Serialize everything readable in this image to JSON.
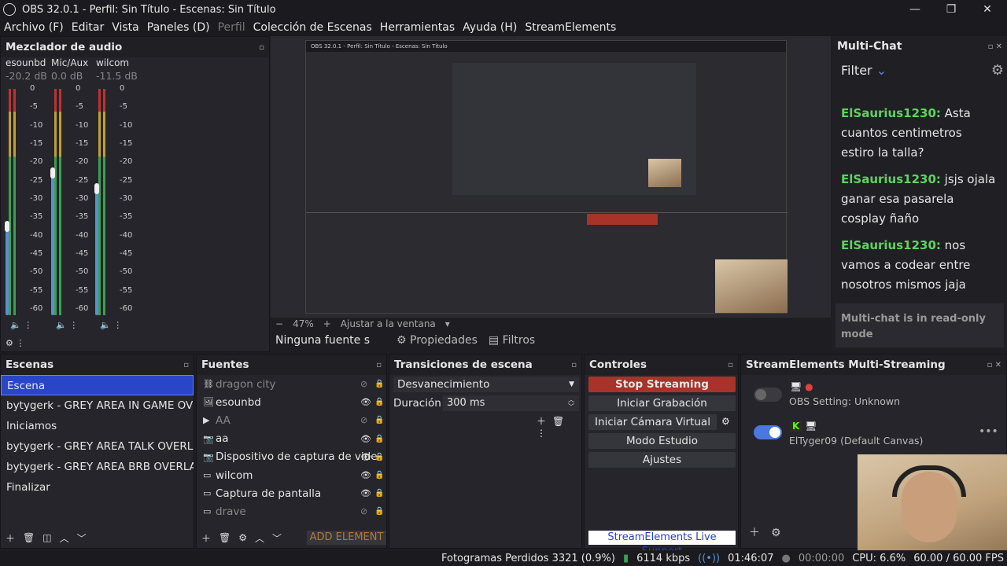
{
  "titlebar": {
    "title": "OBS 32.0.1 - Perfil: Sin Título - Escenas: Sin Título",
    "min": "—",
    "max": "❐",
    "close": "✕"
  },
  "menu": [
    "Archivo (F)",
    "Editar",
    "Vista",
    "Paneles (D)",
    "Perfil",
    "Colección de Escenas",
    "Herramientas",
    "Ayuda (H)",
    "StreamElements"
  ],
  "mixer": {
    "title": "Mezclador de audio",
    "channels": [
      {
        "name": "esounbd",
        "db": "-20.2 dB"
      },
      {
        "name": "Mic/Aux",
        "db": "0.0 dB"
      },
      {
        "name": "wilcom",
        "db": "-11.5 dB"
      }
    ],
    "ticks": [
      "0",
      "-5",
      "-10",
      "-15",
      "-20",
      "-25",
      "-30",
      "-35",
      "-40",
      "-45",
      "-50",
      "-55",
      "-60"
    ]
  },
  "preview": {
    "zoom": "47%",
    "fit": "Ajustar a la ventana",
    "minus": "−",
    "plus": "+"
  },
  "sourcebar": {
    "no_source": "Ninguna fuente s",
    "properties": "Propiedades",
    "filters": "Filtros"
  },
  "multichat": {
    "title": "Multi-Chat",
    "filter": "Filter",
    "messages": [
      {
        "user": "ElSaurius1230:",
        "text": "Asta cuantos centimetros estiro la talla?"
      },
      {
        "user": "ElSaurius1230:",
        "text": "jsjs ojala ganar esa pasarela cosplay ñaño"
      },
      {
        "user": "ElSaurius1230:",
        "text": "nos vamos a codear entre nosotros mismos jaja"
      }
    ],
    "readonly": "Multi-chat is in read-only mode"
  },
  "scenes": {
    "title": "Escenas",
    "items": [
      "Escena",
      "bytygerk - GREY AREA IN GAME OVERLAY",
      "Iniciamos",
      "bytygerk - GREY AREA TALK OVERLAY",
      "bytygerk - GREY AREA BRB OVERLAY",
      "Finalizar"
    ]
  },
  "sources": {
    "title": "Fuentes",
    "items": [
      {
        "name": "dragon city",
        "dim": true
      },
      {
        "name": "esounbd"
      },
      {
        "name": "AA",
        "dim": true
      },
      {
        "name": "aa"
      },
      {
        "name": "Dispositivo de captura de vide"
      },
      {
        "name": "wilcom"
      },
      {
        "name": "Captura de pantalla"
      },
      {
        "name": "drave",
        "dim": true
      }
    ],
    "add": "ADD ELEMENT"
  },
  "transitions": {
    "title": "Transiciones de escena",
    "selected": "Desvanecimiento",
    "duration_label": "Duración",
    "duration": "300 ms"
  },
  "controls": {
    "title": "Controles",
    "stop": "Stop Streaming",
    "record": "Iniciar Grabación",
    "vcam": "Iniciar Cámara Virtual",
    "studio": "Modo Estudio",
    "settings": "Ajustes",
    "support": "StreamElements Live Support"
  },
  "semulti": {
    "title": "StreamElements Multi-Streaming",
    "obs_setting": "OBS Setting: Unknown",
    "canvas": "ElTyger09 (Default Canvas)"
  },
  "status": {
    "dropped": "Fotogramas Perdidos 3321 (0.9%)",
    "kbps": "6114 kbps",
    "stream_time": "01:46:07",
    "rec_time": "00:00:00",
    "cpu": "CPU: 6.6%",
    "fps": "60.00 / 60.00 FPS"
  },
  "nested": {
    "title": "OBS 32.0.1 - Perfil: Sin Título - Escenas: Sin Título"
  },
  "colors": {
    "accent": "#2946c9",
    "stop": "#a8332a",
    "chat_user": "#5fd35f",
    "toggle": "#4a78e0"
  }
}
